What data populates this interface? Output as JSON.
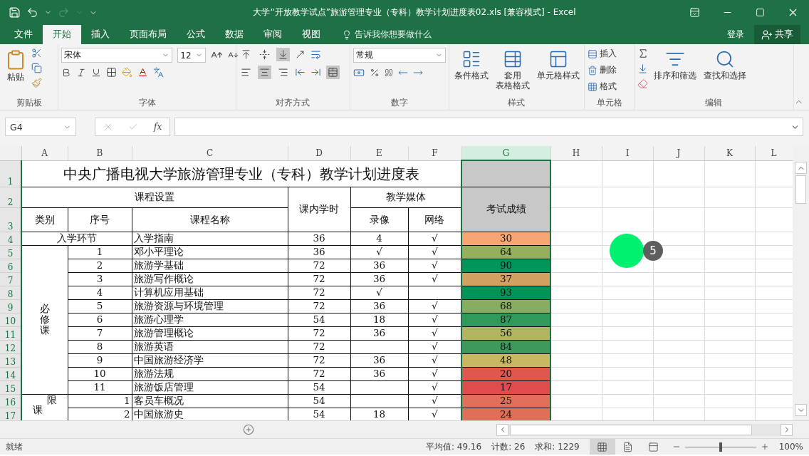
{
  "window": {
    "title": "大学“开放教学试点”旅游管理专业（专科）教学计划进度表02.xls  [兼容模式] - Excel"
  },
  "tabs": [
    {
      "label": "文件",
      "selected": false
    },
    {
      "label": "开始",
      "selected": true
    },
    {
      "label": "插入",
      "selected": false
    },
    {
      "label": "页面布局",
      "selected": false
    },
    {
      "label": "公式",
      "selected": false
    },
    {
      "label": "数据",
      "selected": false
    },
    {
      "label": "审阅",
      "selected": false
    },
    {
      "label": "视图",
      "selected": false
    }
  ],
  "tell_me": "告诉我你想要做什么",
  "sign_in": "登录",
  "share": "共享",
  "ribbon": {
    "clipboard": {
      "label": "剪贴板",
      "paste": "粘贴"
    },
    "font": {
      "label": "字体",
      "font": "宋体",
      "size": "12"
    },
    "alignment": {
      "label": "对齐方式",
      "vertical_buttons": [
        {
          "selected": false
        },
        {
          "selected": false
        },
        {
          "selected": true
        }
      ],
      "horizontal_buttons": [
        {
          "selected": false
        },
        {
          "selected": true
        },
        {
          "selected": false
        }
      ],
      "merged": true
    },
    "number": {
      "label": "数字",
      "format": "常规"
    },
    "styles": {
      "label": "样式",
      "buttons": [
        {
          "lines": [
            "条件格式"
          ]
        },
        {
          "lines": [
            "套用",
            "表格格式"
          ]
        },
        {
          "lines": [
            "单元格样式"
          ]
        }
      ]
    },
    "cells": {
      "label": "单元格",
      "buttons": [
        "插入",
        "删除",
        "格式"
      ]
    },
    "editing": {
      "label": "编辑",
      "buttons": [
        "排序和筛选",
        "查找和选择"
      ]
    }
  },
  "formula_bar": {
    "name_box": "G4",
    "function_label": "fx"
  },
  "sheet": {
    "columns": [
      {
        "label": "A",
        "selected": false
      },
      {
        "label": "B",
        "selected": false
      },
      {
        "label": "C",
        "selected": false
      },
      {
        "label": "D",
        "selected": false
      },
      {
        "label": "E",
        "selected": false
      },
      {
        "label": "F",
        "selected": false
      },
      {
        "label": "G",
        "selected": true
      },
      {
        "label": "H",
        "selected": false
      },
      {
        "label": "I",
        "selected": false
      },
      {
        "label": "J",
        "selected": false
      },
      {
        "label": "K",
        "selected": false
      },
      {
        "label": "L",
        "selected": false
      }
    ],
    "row_numbers": [
      "1",
      "2",
      "3",
      "4",
      "5",
      "6",
      "7",
      "8",
      "9",
      "10",
      "11",
      "12",
      "13",
      "14",
      "15",
      "16",
      "17"
    ],
    "title": "中央广播电视大学旅游管理专业（专科）教学计划进度表",
    "headers": {
      "course_setup": "课程设置",
      "hours": "课内学时",
      "media": "教学媒体",
      "score": "考试成绩",
      "category": "类别",
      "seq": "序号",
      "name": "课程名称",
      "video": "录像",
      "network": "网络"
    },
    "groups": [
      {
        "kind": "intro",
        "label": "入学环节",
        "rows": [
          {
            "name": "入学指南",
            "hours": "36",
            "video": "4",
            "network": "√",
            "score": "30",
            "color": "#f8a574"
          }
        ]
      },
      {
        "kind": "required",
        "label": "必修课",
        "rows": [
          {
            "seq": "1",
            "name": "邓小平理论",
            "hours": "36",
            "video": "√",
            "network": "√",
            "score": "64",
            "color": "#94b05c"
          },
          {
            "seq": "2",
            "name": "旅游学基础",
            "hours": "72",
            "video": "36",
            "network": "√",
            "score": "90",
            "color": "#00955a"
          },
          {
            "seq": "3",
            "name": "旅游写作概论",
            "hours": "72",
            "video": "36",
            "network": "√",
            "score": "37",
            "color": "#d2a060"
          },
          {
            "seq": "4",
            "name": "计算机应用基础",
            "hours": "72",
            "video": "√",
            "score": "93",
            "color": "#009459"
          },
          {
            "seq": "5",
            "name": "旅游资源与环境管理",
            "hours": "72",
            "video": "36",
            "network": "√",
            "score": "68",
            "color": "#86ad60"
          },
          {
            "seq": "6",
            "name": "旅游心理学",
            "hours": "54",
            "video": "18",
            "network": "√",
            "score": "87",
            "color": "#2f9a5a"
          },
          {
            "seq": "7",
            "name": "旅游管理概论",
            "hours": "72",
            "video": "36",
            "network": "√",
            "score": "56",
            "color": "#b3b460"
          },
          {
            "seq": "8",
            "name": "旅游英语",
            "hours": "72",
            "network": "√",
            "score": "84",
            "color": "#3e9a5c"
          },
          {
            "seq": "9",
            "name": "中国旅游经济学",
            "hours": "72",
            "video": "36",
            "network": "√",
            "score": "48",
            "color": "#c8b860"
          },
          {
            "seq": "10",
            "name": "旅游法规",
            "hours": "72",
            "video": "36",
            "network": "√",
            "score": "20",
            "color": "#e0574f"
          },
          {
            "seq": "11",
            "name": "旅游饭店管理",
            "hours": "54",
            "network": "√",
            "score": "17",
            "color": "#de4c4d"
          }
        ]
      },
      {
        "kind": "elective",
        "label_parts": [
          "限",
          "课"
        ],
        "rows": [
          {
            "seq": "1",
            "name": "客员车概况",
            "hours": "54",
            "network": "√",
            "score": "25",
            "color": "#e0705a"
          },
          {
            "seq": "2",
            "name": "中国旅游史",
            "hours": "54",
            "video": "18",
            "network": "√",
            "score": "24",
            "color": "#e06e58"
          }
        ]
      }
    ]
  },
  "step_marker": {
    "number": "5"
  },
  "status_bar": {
    "status": "就绪",
    "average": "平均值: 49.16",
    "count": "计数: 26",
    "sum": "求和: 1229",
    "view_buttons": [
      {
        "selected": true
      },
      {
        "selected": false
      },
      {
        "selected": false
      }
    ],
    "zoom_slider": {
      "level": 0.5
    },
    "zoom": "100%"
  }
}
